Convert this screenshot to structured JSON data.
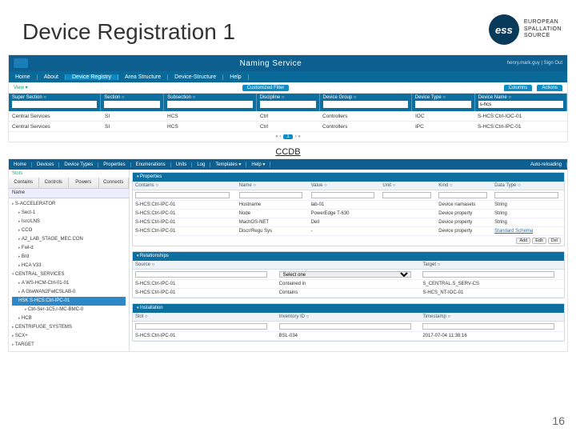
{
  "title": "Device Registration 1",
  "org": {
    "lines": [
      "EUROPEAN",
      "SPALLATION",
      "SOURCE"
    ],
    "logo": "ess"
  },
  "pagenum": "16",
  "naming": {
    "app_title": "Naming Service",
    "user": "henry.mark.guy  |  Sign Out",
    "menu": [
      "Home",
      "About",
      "Device Registry",
      "Area Structure",
      "Device-Structure",
      "Help"
    ],
    "active_menu": 2,
    "view_label": "View  ▾",
    "custom_filter": "Customized Filter",
    "columns_btn": "Columns",
    "actions_btn": "Actions",
    "filters": [
      {
        "label": "Super Section ○"
      },
      {
        "label": "Section ○"
      },
      {
        "label": "Subsection ○"
      },
      {
        "label": "Discipline ○"
      },
      {
        "label": "Device Group ○"
      },
      {
        "label": "Device Type ○"
      },
      {
        "label": "Device Name ○",
        "value": "s-hcs"
      }
    ],
    "rows": [
      [
        "Central Services",
        "SI",
        "HCS",
        "Ctrl",
        "Controllers",
        "IOC",
        "S-HCS:Ctrl-IOC-01"
      ],
      [
        "Central Services",
        "SI",
        "HCS",
        "Ctrl",
        "Controllers",
        "IPC",
        "S-HCS:Ctrl-IPC-01"
      ]
    ],
    "pager": {
      "page": "1"
    }
  },
  "ccdb_label": "CCDB",
  "ccdb": {
    "menu": [
      "Home",
      "Devices",
      "Device Types",
      "Properties",
      "Enumerations",
      "Units",
      "Log",
      "Templates ▾",
      "Help ▾"
    ],
    "reload": "Auto-reloading",
    "left_tabs": [
      "Contains",
      "Controls",
      "Powers",
      "Connects"
    ],
    "tree_header": "Name",
    "tree": [
      {
        "t": "S-ACCELERATOR",
        "lvl": 0,
        "cls": "exp"
      },
      {
        "t": "Sect-1",
        "lvl": 1,
        "cls": "exp"
      },
      {
        "t": "Isrc/LNS",
        "lvl": 1,
        "cls": "exp"
      },
      {
        "t": "CCO",
        "lvl": 1,
        "cls": "exp"
      },
      {
        "t": "A2_LAB_STAGE_MEC.CON",
        "lvl": 1,
        "cls": "exp"
      },
      {
        "t": "Fwl-d",
        "lvl": 1,
        "cls": "exp"
      },
      {
        "t": "Brd",
        "lvl": 1,
        "cls": "exp"
      },
      {
        "t": "HCA V33",
        "lvl": 1,
        "cls": "exp"
      },
      {
        "t": "CENTRAL_SERVICES",
        "lvl": 0,
        "cls": "opn"
      },
      {
        "t": "A WS-HCM-Ctrl-01-01",
        "lvl": 1,
        "cls": "exp"
      },
      {
        "t": "A GtwWAN2FwlCSLAB-0",
        "lvl": 1,
        "cls": "exp"
      },
      {
        "t": "HSK S-HCS:Ctrl-IPC-01",
        "lvl": 1,
        "cls": "sel"
      },
      {
        "t": "Ctrl-Ser-1C5.r-MC-BMC-0",
        "lvl": 2,
        "cls": "exp"
      },
      {
        "t": "HCB",
        "lvl": 1,
        "cls": "exp"
      },
      {
        "t": "CENTRIFUGE_SYSTEMS",
        "lvl": 0,
        "cls": "exp"
      },
      {
        "t": "SCX+",
        "lvl": 0,
        "cls": "exp"
      },
      {
        "t": "TARGET",
        "lvl": 0,
        "cls": "exp"
      }
    ],
    "props": {
      "title": "Properties",
      "headers": [
        "Contains ○",
        "Name ○",
        "Value ○",
        "Unit ○",
        "Kind ○",
        "Data Type ○"
      ],
      "rows": [
        [
          "S-HCS:Ctrl-IPC-01",
          "Hostname",
          "lab-01",
          "",
          "Device namasets",
          "String"
        ],
        [
          "S-HCS:Ctrl-IPC-01",
          "Node",
          "PowerEdge T-630",
          "",
          "Device property",
          "String"
        ],
        [
          "S-HCS:Ctrl-IPC-01",
          "MachOS-NET",
          "Dell",
          "",
          "Device property",
          "String"
        ],
        [
          "S-HCS:Ctrl-IPC-01",
          "Discr/Regu Sys",
          "-",
          "",
          "Device property",
          "Standard Schema"
        ]
      ],
      "btns": [
        "Add",
        "Edit",
        "Del"
      ]
    },
    "rel": {
      "title": "Relationships",
      "headers": [
        "Source ○",
        "",
        "Target ○"
      ],
      "rows": [
        [
          "S-HCS:Ctrl-IPC-01",
          "Contained in",
          "S_CENTRAL.S_SERV-CS"
        ],
        [
          "S-HCS:Ctrl-IPC-01",
          "Contains",
          "S-HCS_NT-IOC-01"
        ]
      ]
    },
    "inst": {
      "title": "Installation",
      "headers": [
        "Slot ○",
        "Inventory ID ○",
        "Timestamp ○"
      ],
      "rows": [
        [
          "S-HCS:Ctrl-IPC-01",
          "BSL-034",
          "2017-07-04 11:38:16"
        ]
      ]
    }
  }
}
